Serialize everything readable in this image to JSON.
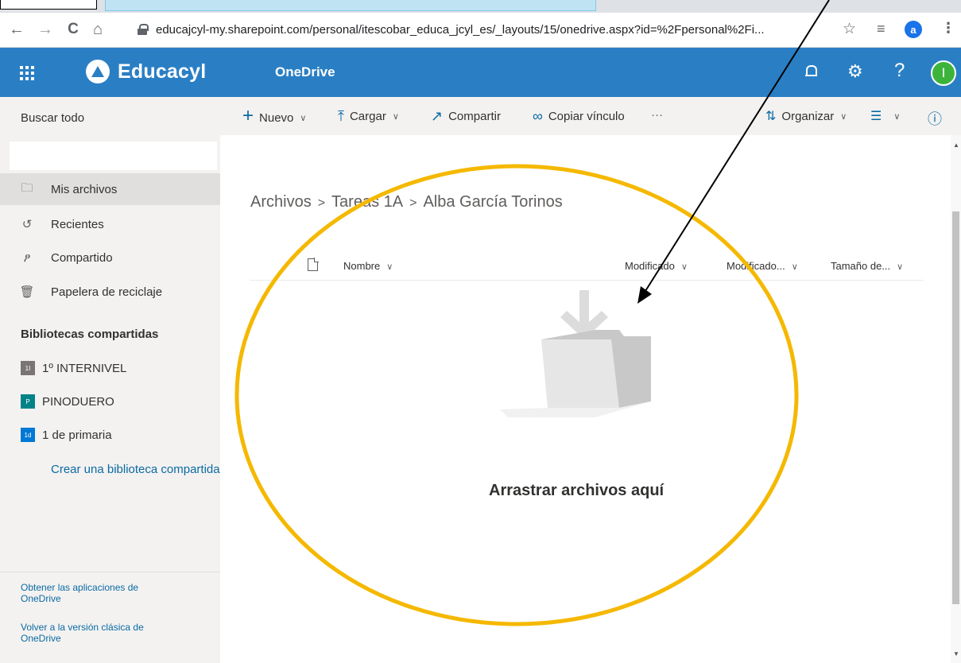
{
  "browser": {
    "url": "educajcyl-my.sharepoint.com/personal/itescobar_educa_jcyl_es/_layouts/15/onedrive.aspx?id=%2Fpersonal%2Fi...",
    "profile_initial": "a",
    "nav_back_icon": "←",
    "nav_forward_icon": "→",
    "reload_icon": "C",
    "home_icon": "⌂",
    "star_icon": "☆",
    "reading_list_icon": "≡",
    "menu_icon": "⋮"
  },
  "suite": {
    "brand": "Educacyl",
    "app_name": "OneDrive",
    "user_initial": "I",
    "gear_icon": "⚙",
    "help_icon": "?",
    "accent_color": "#2a7fc4"
  },
  "sidebar": {
    "search_label": "Buscar todo",
    "search_placeholder": "",
    "nav": [
      {
        "label": "Mis archivos",
        "icon": "folder-icon",
        "glyph": "🗀"
      },
      {
        "label": "Recientes",
        "icon": "history-icon",
        "glyph": "↺"
      },
      {
        "label": "Compartido",
        "icon": "people-icon",
        "glyph": "ፆ"
      },
      {
        "label": "Papelera de reciclaje",
        "icon": "trash-icon",
        "glyph": "🗑"
      }
    ],
    "libraries_header": "Bibliotecas compartidas",
    "libraries": [
      {
        "badge": "1I",
        "label": "1º INTERNIVEL",
        "color": "#7a7574"
      },
      {
        "badge": "P",
        "label": "PINODUERO",
        "color": "#038387"
      },
      {
        "badge": "1d",
        "label": "1 de primaria",
        "color": "#0078d4"
      }
    ],
    "create_library": "Crear una biblioteca compartida",
    "footer_links": [
      "Obtener las aplicaciones de OneDrive",
      "Volver a la versión clásica de OneDrive"
    ]
  },
  "commands": {
    "new": "Nuevo",
    "upload": "Cargar",
    "share": "Compartir",
    "copy_link": "Copiar vínculo",
    "more": "···",
    "sort": "Organizar",
    "chevron": "∨",
    "new_icon": "+",
    "upload_icon": "⤒",
    "share_icon": "↗",
    "link_icon": "∞",
    "sort_icon": "⇅",
    "view_icon": "☰",
    "info_icon": "ⓘ"
  },
  "breadcrumb": [
    "Archivos",
    "Tareas 1A",
    "Alba García Torinos"
  ],
  "breadcrumb_separator": ">",
  "columns": {
    "name": "Nombre",
    "modified": "Modificado",
    "modified_by": "Modificado...",
    "size": "Tamaño de...",
    "chevron": "∨"
  },
  "empty_state": "Arrastrar archivos aquí",
  "annotation": {
    "ellipse_color": "#f5b800",
    "arrow_color": "#000000"
  }
}
